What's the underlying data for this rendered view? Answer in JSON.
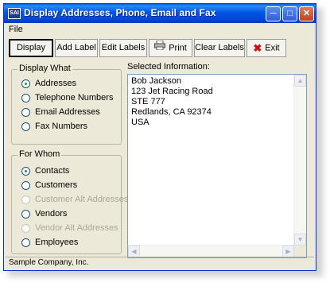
{
  "window": {
    "title": "Display Addresses, Phone, Email and Fax",
    "app_icon_text": "SAI"
  },
  "menu": {
    "file_label": "File"
  },
  "toolbar": {
    "display_label": "Display",
    "add_label": "Add Label",
    "edit_labels": "Edit Labels",
    "print_label": "Print",
    "clear_labels": "Clear Labels",
    "exit_label": "Exit"
  },
  "display_what": {
    "title": "Display What",
    "options": [
      {
        "label": "Addresses",
        "selected": true,
        "enabled": true
      },
      {
        "label": "Telephone Numbers",
        "selected": false,
        "enabled": true
      },
      {
        "label": "Email Addresses",
        "selected": false,
        "enabled": true
      },
      {
        "label": "Fax Numbers",
        "selected": false,
        "enabled": true
      }
    ]
  },
  "for_whom": {
    "title": "For Whom",
    "options": [
      {
        "label": "Contacts",
        "selected": true,
        "enabled": true
      },
      {
        "label": "Customers",
        "selected": false,
        "enabled": true
      },
      {
        "label": "Customer Alt Addresses",
        "selected": false,
        "enabled": false
      },
      {
        "label": "Vendors",
        "selected": false,
        "enabled": true
      },
      {
        "label": "Vendor Alt Addresses",
        "selected": false,
        "enabled": false
      },
      {
        "label": "Employees",
        "selected": false,
        "enabled": true
      }
    ]
  },
  "selected_info": {
    "label": "Selected Information:",
    "lines": [
      "Bob Jackson",
      "123 Jet Racing Road",
      "STE 777",
      "Redlands, CA  92374",
      "USA"
    ]
  },
  "status": {
    "text": "Sample Company, Inc."
  }
}
